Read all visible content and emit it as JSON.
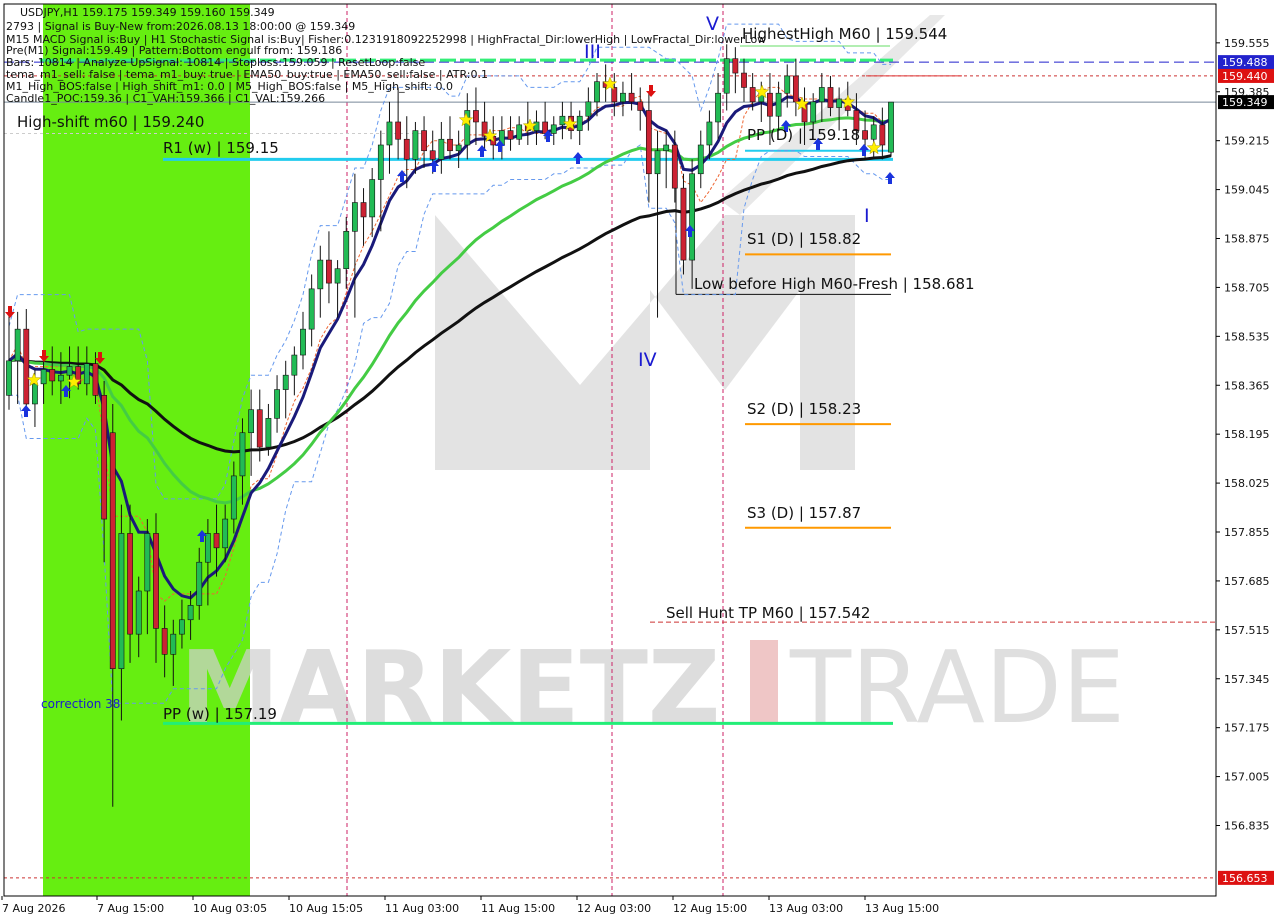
{
  "chart_data": {
    "type": "candlestick",
    "title": "USDJPY,H1  159.175 159.349 159.160 159.349",
    "info_lines": [
      "2793 | Signal is Buy-New from:2026.08.13 18:00:00 @ 159.349",
      "M15 MACD Signal is:Buy | H1 Stochastic Signal is:Buy| Fisher:0.1231918092252998 | HighFractal_Dir:lowerHigh | LowFractal_Dir:lowerLow",
      "Pre(M1) Signal:159.49 | Pattern:Bottom engulf from: 159.186",
      "Bars: 10814 | Analyze UpSignal: 10814 | Stoploss:159.059 | ResetLoop:false",
      "tema_m1_sell: false | tema_m1_buy: true | EMA50_buy:true | EMA50_sell:false | ATR:0.1",
      "M1_High_BOS:false | High_shift_m1: 0.0 | M5_High_BOS:false | M5_High_shift: 0.0",
      "Candle1_POC:159.36 | C1_VAH:159.366 | C1_VAL:159.266"
    ],
    "y_ticks": [
      "159.555",
      "159.385",
      "159.215",
      "159.045",
      "158.875",
      "158.705",
      "158.535",
      "158.365",
      "158.195",
      "158.025",
      "157.855",
      "157.685",
      "157.515",
      "157.345",
      "157.175",
      "157.005",
      "156.835"
    ],
    "ylim": [
      156.59,
      159.69
    ],
    "x_ticks": [
      "7 Aug 2026",
      "7 Aug 15:00",
      "10 Aug 03:05",
      "10 Aug 15:05",
      "11 Aug 03:00",
      "11 Aug 15:00",
      "12 Aug 03:00",
      "12 Aug 15:00",
      "13 Aug 03:00",
      "13 Aug 15:00"
    ],
    "price_tags": [
      {
        "label": "159.488",
        "value": 159.488,
        "bg": "#2222cc"
      },
      {
        "label": "159.440",
        "value": 159.44,
        "bg": "#dd1111"
      },
      {
        "label": "159.349",
        "value": 159.349,
        "bg": "#000000"
      },
      {
        "label": "156.653",
        "value": 156.653,
        "bg": "#dd1111"
      }
    ],
    "levels": [
      {
        "label": "HighestHigh    M60 | 159.544",
        "value": 159.544
      },
      {
        "label": "High-shift m60 | 159.240",
        "value": 159.24
      },
      {
        "label": "R1 (w) | 159.15",
        "value": 159.15
      },
      {
        "label": "PP (D) | 159.18",
        "value": 159.18
      },
      {
        "label": "S1 (D) | 158.82",
        "value": 158.82
      },
      {
        "label": "Low before High   M60-Fresh | 158.681",
        "value": 158.681
      },
      {
        "label": "S2 (D) | 158.23",
        "value": 158.23
      },
      {
        "label": "S3 (D) | 157.87",
        "value": 157.87
      },
      {
        "label": "Sell Hunt TP M60 | 157.542",
        "value": 157.542
      },
      {
        "label": "PP (w) | 157.19",
        "value": 157.19
      }
    ],
    "annotations": [
      "correction 38"
    ],
    "wave_labels": [
      "V",
      "III",
      "IV",
      "I"
    ],
    "watermark": "MARKETZ TRADE",
    "candles": [
      {
        "o": 158.33,
        "h": 158.62,
        "l": 158.28,
        "c": 158.45
      },
      {
        "o": 158.45,
        "h": 158.62,
        "l": 158.3,
        "c": 158.56
      },
      {
        "o": 158.56,
        "h": 158.63,
        "l": 158.26,
        "c": 158.3
      },
      {
        "o": 158.3,
        "h": 158.42,
        "l": 158.22,
        "c": 158.37
      },
      {
        "o": 158.37,
        "h": 158.45,
        "l": 158.3,
        "c": 158.42
      },
      {
        "o": 158.42,
        "h": 158.5,
        "l": 158.33,
        "c": 158.38
      },
      {
        "o": 158.38,
        "h": 158.48,
        "l": 158.3,
        "c": 158.4
      },
      {
        "o": 158.4,
        "h": 158.5,
        "l": 158.32,
        "c": 158.43
      },
      {
        "o": 158.43,
        "h": 158.5,
        "l": 158.35,
        "c": 158.37
      },
      {
        "o": 158.37,
        "h": 158.5,
        "l": 158.33,
        "c": 158.44
      },
      {
        "o": 158.44,
        "h": 158.48,
        "l": 158.3,
        "c": 158.33
      },
      {
        "o": 158.33,
        "h": 158.38,
        "l": 157.75,
        "c": 157.9
      },
      {
        "o": 158.2,
        "h": 158.3,
        "l": 156.9,
        "c": 157.38
      },
      {
        "o": 157.38,
        "h": 157.95,
        "l": 157.2,
        "c": 157.85
      },
      {
        "o": 157.85,
        "h": 157.95,
        "l": 157.4,
        "c": 157.5
      },
      {
        "o": 157.5,
        "h": 157.7,
        "l": 157.42,
        "c": 157.65
      },
      {
        "o": 157.65,
        "h": 157.9,
        "l": 157.5,
        "c": 157.85
      },
      {
        "o": 157.85,
        "h": 157.92,
        "l": 157.4,
        "c": 157.52
      },
      {
        "o": 157.52,
        "h": 157.6,
        "l": 157.35,
        "c": 157.43
      },
      {
        "o": 157.43,
        "h": 157.55,
        "l": 157.32,
        "c": 157.5
      },
      {
        "o": 157.5,
        "h": 157.62,
        "l": 157.45,
        "c": 157.55
      },
      {
        "o": 157.55,
        "h": 157.65,
        "l": 157.48,
        "c": 157.6
      },
      {
        "o": 157.6,
        "h": 157.8,
        "l": 157.55,
        "c": 157.75
      },
      {
        "o": 157.75,
        "h": 157.9,
        "l": 157.6,
        "c": 157.85
      },
      {
        "o": 157.85,
        "h": 157.95,
        "l": 157.7,
        "c": 157.8
      },
      {
        "o": 157.8,
        "h": 157.95,
        "l": 157.75,
        "c": 157.9
      },
      {
        "o": 157.9,
        "h": 158.1,
        "l": 157.85,
        "c": 158.05
      },
      {
        "o": 158.05,
        "h": 158.25,
        "l": 157.95,
        "c": 158.2
      },
      {
        "o": 158.2,
        "h": 158.35,
        "l": 158.05,
        "c": 158.28
      },
      {
        "o": 158.28,
        "h": 158.35,
        "l": 158.1,
        "c": 158.15
      },
      {
        "o": 158.15,
        "h": 158.3,
        "l": 158.12,
        "c": 158.25
      },
      {
        "o": 158.25,
        "h": 158.4,
        "l": 158.2,
        "c": 158.35
      },
      {
        "o": 158.35,
        "h": 158.45,
        "l": 158.25,
        "c": 158.4
      },
      {
        "o": 158.4,
        "h": 158.5,
        "l": 158.33,
        "c": 158.47
      },
      {
        "o": 158.47,
        "h": 158.62,
        "l": 158.42,
        "c": 158.56
      },
      {
        "o": 158.56,
        "h": 158.75,
        "l": 158.5,
        "c": 158.7
      },
      {
        "o": 158.7,
        "h": 158.85,
        "l": 158.6,
        "c": 158.8
      },
      {
        "o": 158.8,
        "h": 158.9,
        "l": 158.65,
        "c": 158.72
      },
      {
        "o": 158.72,
        "h": 158.8,
        "l": 158.6,
        "c": 158.77
      },
      {
        "o": 158.77,
        "h": 158.95,
        "l": 158.7,
        "c": 158.9
      },
      {
        "o": 158.9,
        "h": 159.1,
        "l": 158.6,
        "c": 159.0
      },
      {
        "o": 159.0,
        "h": 159.05,
        "l": 158.85,
        "c": 158.95
      },
      {
        "o": 158.95,
        "h": 159.12,
        "l": 158.88,
        "c": 159.08
      },
      {
        "o": 159.08,
        "h": 159.25,
        "l": 158.9,
        "c": 159.2
      },
      {
        "o": 159.2,
        "h": 159.35,
        "l": 159.1,
        "c": 159.28
      },
      {
        "o": 159.28,
        "h": 159.4,
        "l": 159.15,
        "c": 159.22
      },
      {
        "o": 159.22,
        "h": 159.3,
        "l": 159.05,
        "c": 159.15
      },
      {
        "o": 159.15,
        "h": 159.28,
        "l": 159.1,
        "c": 159.25
      },
      {
        "o": 159.25,
        "h": 159.3,
        "l": 159.12,
        "c": 159.18
      },
      {
        "o": 159.18,
        "h": 159.25,
        "l": 159.1,
        "c": 159.15
      },
      {
        "o": 159.15,
        "h": 159.28,
        "l": 159.1,
        "c": 159.22
      },
      {
        "o": 159.22,
        "h": 159.3,
        "l": 159.15,
        "c": 159.18
      },
      {
        "o": 159.18,
        "h": 159.25,
        "l": 159.12,
        "c": 159.2
      },
      {
        "o": 159.2,
        "h": 159.38,
        "l": 159.15,
        "c": 159.32
      },
      {
        "o": 159.32,
        "h": 159.4,
        "l": 159.2,
        "c": 159.28
      },
      {
        "o": 159.28,
        "h": 159.35,
        "l": 159.18,
        "c": 159.23
      },
      {
        "o": 159.23,
        "h": 159.3,
        "l": 159.15,
        "c": 159.2
      },
      {
        "o": 159.2,
        "h": 159.3,
        "l": 159.15,
        "c": 159.25
      },
      {
        "o": 159.25,
        "h": 159.3,
        "l": 159.18,
        "c": 159.22
      },
      {
        "o": 159.22,
        "h": 159.3,
        "l": 159.2,
        "c": 159.27
      },
      {
        "o": 159.27,
        "h": 159.35,
        "l": 159.2,
        "c": 159.25
      },
      {
        "o": 159.25,
        "h": 159.32,
        "l": 159.2,
        "c": 159.28
      },
      {
        "o": 159.28,
        "h": 159.35,
        "l": 159.22,
        "c": 159.24
      },
      {
        "o": 159.24,
        "h": 159.3,
        "l": 159.2,
        "c": 159.27
      },
      {
        "o": 159.27,
        "h": 159.35,
        "l": 159.22,
        "c": 159.3
      },
      {
        "o": 159.3,
        "h": 159.35,
        "l": 159.22,
        "c": 159.25
      },
      {
        "o": 159.25,
        "h": 159.32,
        "l": 159.2,
        "c": 159.3
      },
      {
        "o": 159.3,
        "h": 159.4,
        "l": 159.25,
        "c": 159.35
      },
      {
        "o": 159.35,
        "h": 159.45,
        "l": 159.3,
        "c": 159.42
      },
      {
        "o": 159.42,
        "h": 159.48,
        "l": 159.35,
        "c": 159.4
      },
      {
        "o": 159.4,
        "h": 159.45,
        "l": 159.3,
        "c": 159.35
      },
      {
        "o": 159.35,
        "h": 159.42,
        "l": 159.3,
        "c": 159.38
      },
      {
        "o": 159.38,
        "h": 159.45,
        "l": 159.32,
        "c": 159.35
      },
      {
        "o": 159.35,
        "h": 159.4,
        "l": 159.25,
        "c": 159.32
      },
      {
        "o": 159.32,
        "h": 159.38,
        "l": 159.0,
        "c": 159.1
      },
      {
        "o": 159.1,
        "h": 159.25,
        "l": 158.6,
        "c": 159.18
      },
      {
        "o": 159.18,
        "h": 159.25,
        "l": 159.05,
        "c": 159.2
      },
      {
        "o": 159.2,
        "h": 159.25,
        "l": 159.0,
        "c": 159.05
      },
      {
        "o": 159.05,
        "h": 159.1,
        "l": 158.75,
        "c": 158.8
      },
      {
        "o": 158.8,
        "h": 159.15,
        "l": 158.7,
        "c": 159.1
      },
      {
        "o": 159.1,
        "h": 159.25,
        "l": 159.05,
        "c": 159.2
      },
      {
        "o": 159.2,
        "h": 159.32,
        "l": 159.15,
        "c": 159.28
      },
      {
        "o": 159.28,
        "h": 159.45,
        "l": 159.22,
        "c": 159.38
      },
      {
        "o": 159.38,
        "h": 159.55,
        "l": 159.32,
        "c": 159.5
      },
      {
        "o": 159.5,
        "h": 159.54,
        "l": 159.38,
        "c": 159.45
      },
      {
        "o": 159.45,
        "h": 159.5,
        "l": 159.35,
        "c": 159.4
      },
      {
        "o": 159.4,
        "h": 159.45,
        "l": 159.32,
        "c": 159.35
      },
      {
        "o": 159.35,
        "h": 159.42,
        "l": 159.28,
        "c": 159.38
      },
      {
        "o": 159.38,
        "h": 159.45,
        "l": 159.2,
        "c": 159.3
      },
      {
        "o": 159.3,
        "h": 159.42,
        "l": 159.25,
        "c": 159.38
      },
      {
        "o": 159.38,
        "h": 159.48,
        "l": 159.33,
        "c": 159.44
      },
      {
        "o": 159.44,
        "h": 159.5,
        "l": 159.3,
        "c": 159.35
      },
      {
        "o": 159.35,
        "h": 159.4,
        "l": 159.2,
        "c": 159.28
      },
      {
        "o": 159.28,
        "h": 159.38,
        "l": 159.22,
        "c": 159.35
      },
      {
        "o": 159.35,
        "h": 159.45,
        "l": 159.28,
        "c": 159.4
      },
      {
        "o": 159.4,
        "h": 159.44,
        "l": 159.3,
        "c": 159.33
      },
      {
        "o": 159.33,
        "h": 159.4,
        "l": 159.25,
        "c": 159.36
      },
      {
        "o": 159.36,
        "h": 159.42,
        "l": 159.3,
        "c": 159.32
      },
      {
        "o": 159.32,
        "h": 159.38,
        "l": 159.2,
        "c": 159.25
      },
      {
        "o": 159.25,
        "h": 159.32,
        "l": 159.15,
        "c": 159.22
      },
      {
        "o": 159.22,
        "h": 159.3,
        "l": 159.15,
        "c": 159.27
      },
      {
        "o": 159.27,
        "h": 159.33,
        "l": 159.15,
        "c": 159.2
      },
      {
        "o": 159.175,
        "h": 159.349,
        "l": 159.16,
        "c": 159.349
      }
    ]
  }
}
